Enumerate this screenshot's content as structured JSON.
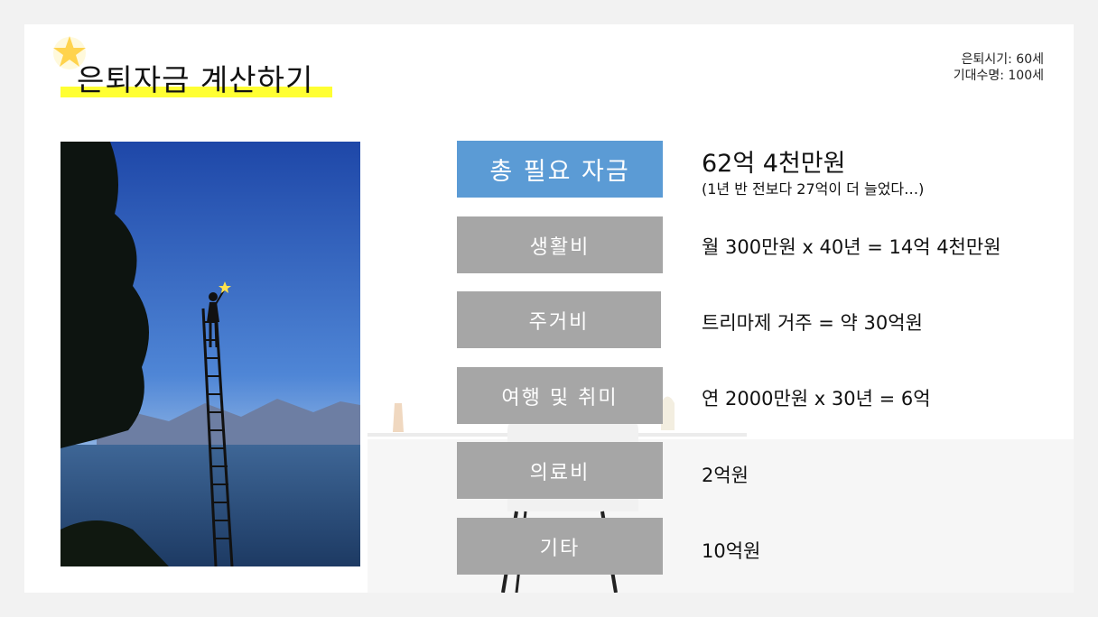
{
  "title": "은퇴자금 계산하기",
  "info": {
    "retirement_age": "은퇴시기: 60세",
    "life_expectancy": "기대수명: 100세"
  },
  "total": {
    "label": "총 필요 자금",
    "value": "62억 4천만원",
    "note": "(1년 반 전보다 27억이 더 늘었다…)"
  },
  "items": [
    {
      "label": "생활비",
      "value": "월 300만원 x 40년  = 14억 4천만원"
    },
    {
      "label": "주거비",
      "value": "트리마제 거주 = 약 30억원"
    },
    {
      "label": "여행 및 취미",
      "value": "연 2000만원 x 30년 = 6억"
    },
    {
      "label": "의료비",
      "value": "2억원"
    },
    {
      "label": "기타",
      "value": "10억원"
    }
  ],
  "colors": {
    "highlight": "#ffff33",
    "primary_box": "#5b9bd5",
    "category_box": "#a6a6a6"
  },
  "icons": [
    "star-icon"
  ]
}
